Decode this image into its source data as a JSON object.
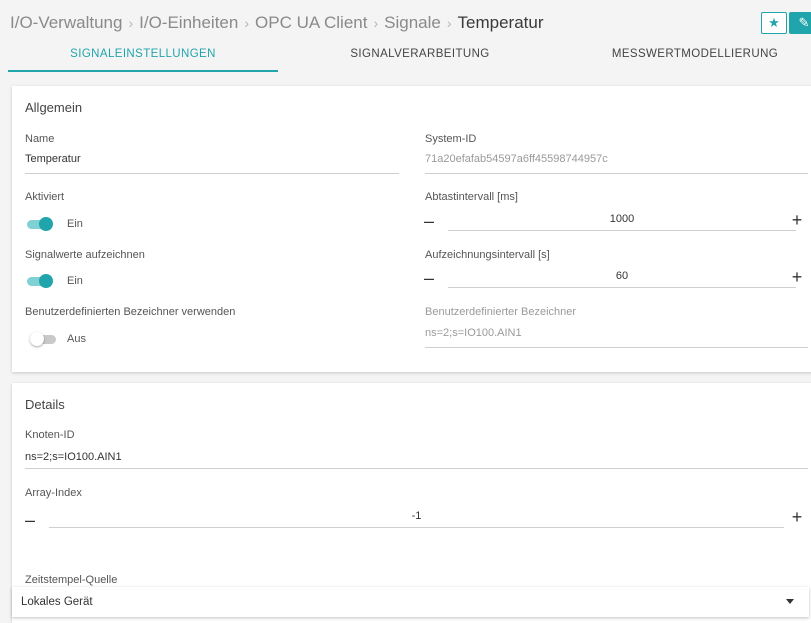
{
  "breadcrumb": {
    "items": [
      "I/O-Verwaltung",
      "I/O-Einheiten",
      "OPC UA Client",
      "Signale"
    ],
    "current": "Temperatur",
    "separator": "›"
  },
  "actions": {
    "favorite_icon": "★",
    "edit_icon": "✎"
  },
  "tabs": [
    {
      "label": "SIGNALEINSTELLUNGEN",
      "active": true
    },
    {
      "label": "SIGNALVERARBEITUNG",
      "active": false
    },
    {
      "label": "MESSWERTMODELLIERUNG",
      "active": false
    }
  ],
  "general": {
    "title": "Allgemein",
    "name": {
      "label": "Name",
      "value": "Temperatur"
    },
    "system_id": {
      "label": "System-ID",
      "value": "71a20efafab54597a6ff45598744957c"
    },
    "activated": {
      "label": "Aktiviert",
      "state": "Ein",
      "on": true
    },
    "sample_interval": {
      "label": "Abtastintervall [ms]",
      "value": "1000",
      "minus": "–",
      "plus": "+"
    },
    "record_values": {
      "label": "Signalwerte aufzeichnen",
      "state": "Ein",
      "on": true
    },
    "record_interval": {
      "label": "Aufzeichnungsintervall [s]",
      "value": "60",
      "minus": "–",
      "plus": "+"
    },
    "custom_identifier_toggle": {
      "label": "Benutzerdefinierten Bezeichner verwenden",
      "state": "Aus",
      "on": false
    },
    "custom_identifier": {
      "label": "Benutzerdefinierter Bezeichner",
      "value": "ns=2;s=IO100.AIN1"
    }
  },
  "details": {
    "title": "Details",
    "node_id": {
      "label": "Knoten-ID",
      "value": "ns=2;s=IO100.AIN1"
    },
    "array_index": {
      "label": "Array-Index",
      "value": "-1",
      "minus": "–",
      "plus": "+"
    },
    "timestamp_source": {
      "label": "Zeitstempel-Quelle",
      "value": "Lokales Gerät"
    }
  },
  "colors": {
    "accent": "#1fa5ab"
  }
}
